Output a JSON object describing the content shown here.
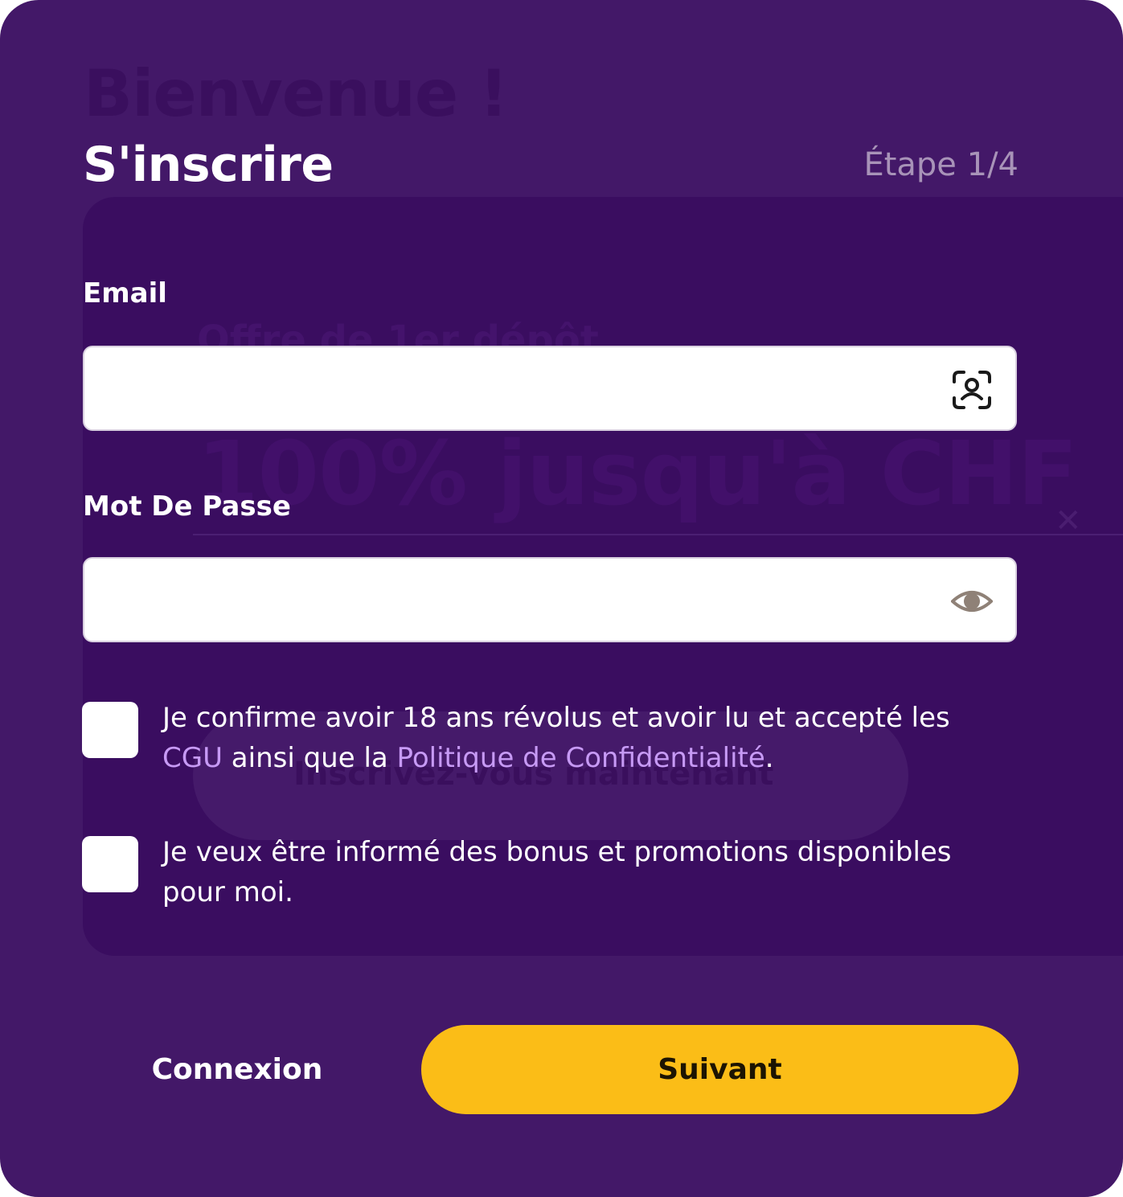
{
  "background": {
    "welcome": "Bienvenue !",
    "offer": "Offre de 1er dépôt",
    "headline": "100% jusqu'à CHF",
    "cta": "Inscrivez-vous maintenant"
  },
  "header": {
    "title": "S'inscrire",
    "step": "Étape 1/4"
  },
  "form": {
    "email": {
      "label": "Email",
      "value": "",
      "icon": "face-id-icon"
    },
    "password": {
      "label": "Mot De Passe",
      "value": "",
      "icon": "eye-icon"
    },
    "terms": {
      "checked": false,
      "text_before": "Je confirme avoir 18 ans révolus et avoir lu et accepté les ",
      "link_cgu": "CGU",
      "text_middle": " ainsi que la ",
      "link_privacy": "Politique de Confidentialité",
      "text_after": "."
    },
    "promotions": {
      "checked": false,
      "text": "Je veux être informé des bonus et promotions disponibles pour moi."
    }
  },
  "actions": {
    "login_label": "Connexion",
    "next_label": "Suivant"
  },
  "colors": {
    "background": "#431868",
    "accent": "#fbbd17",
    "link": "#c79af5"
  }
}
